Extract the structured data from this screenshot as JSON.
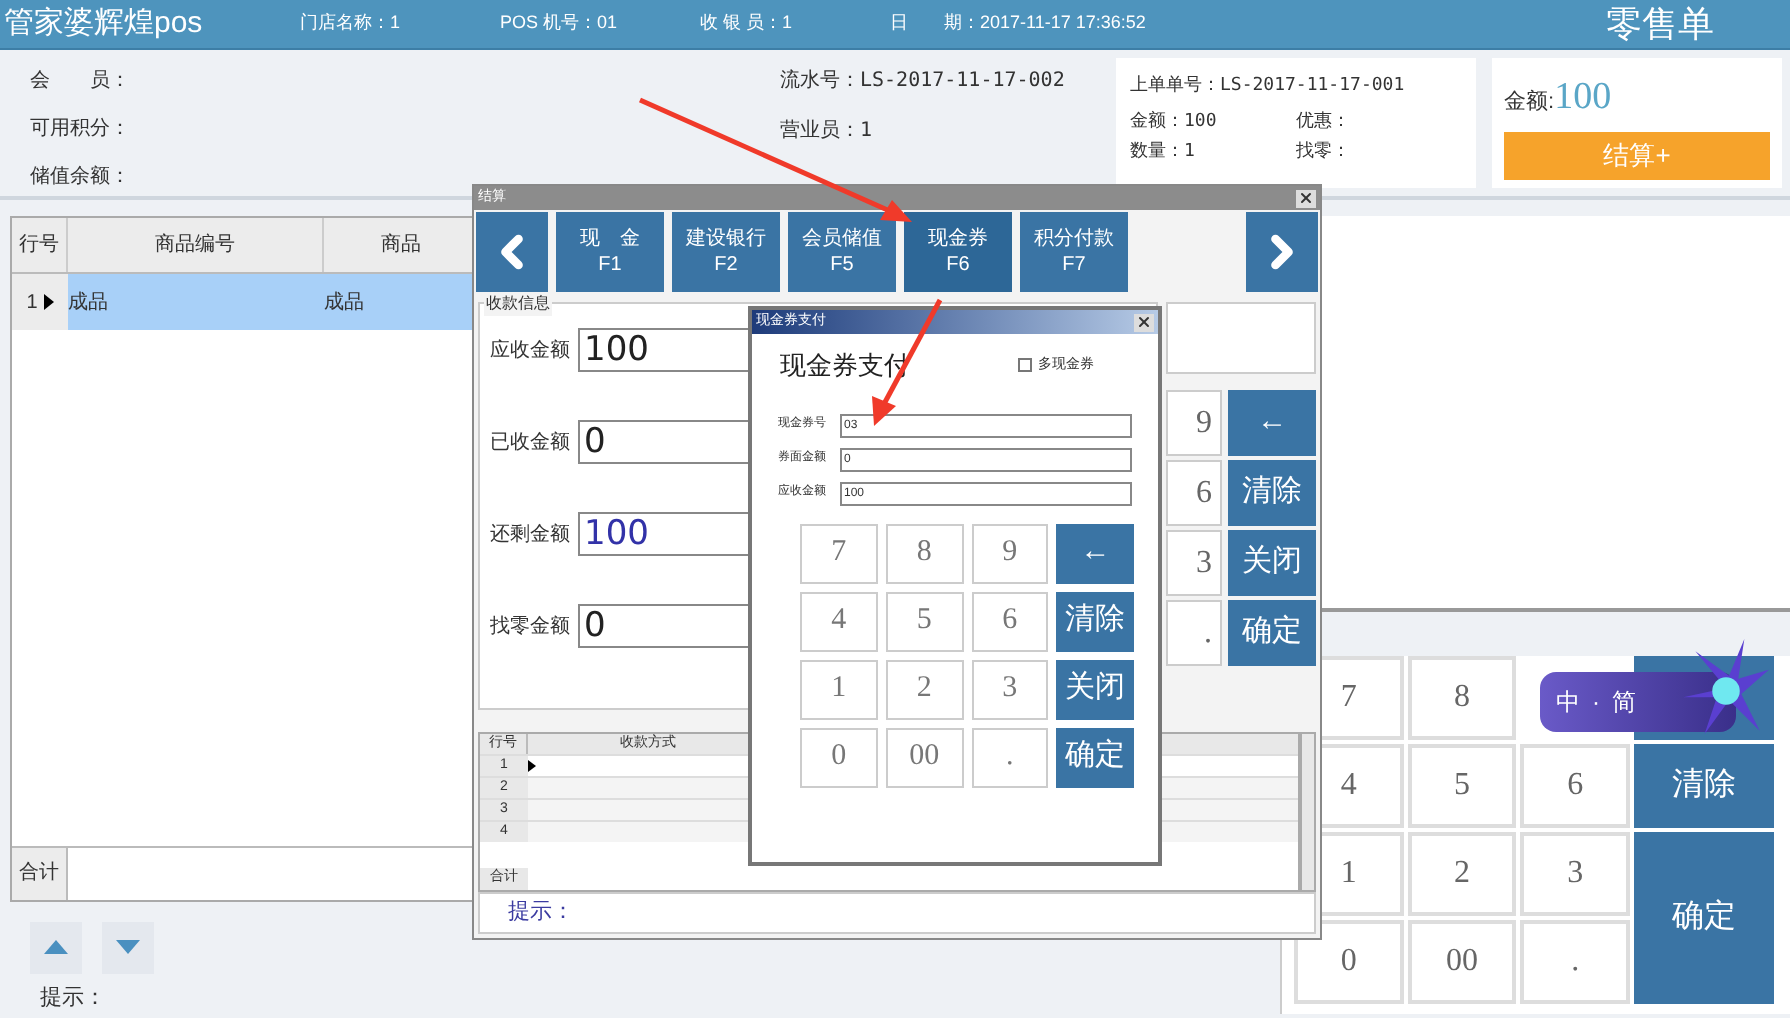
{
  "header": {
    "app_title": "管家婆辉煌pos",
    "store": "门店名称：1",
    "pos_no": "POS 机号：01",
    "cashier": "收 银 员：1",
    "date": "日　　期：2017-11-17 17:36:52",
    "doc_title": "零售单"
  },
  "member": {
    "member_label": "会　　员：",
    "points_label": "可用积分：",
    "balance_label": "储值余额：",
    "serial": "流水号：LS-2017-11-17-002",
    "clerk": "营业员：1"
  },
  "last_order": {
    "number": "上单单号：LS-2017-11-17-001",
    "amount": "金额：100",
    "discount": "优惠：",
    "quantity": "数量：1",
    "change": "找零："
  },
  "total": {
    "label": "金额:",
    "value": "100",
    "checkout_button": "结算+"
  },
  "sales_table": {
    "columns": [
      "行号",
      "商品编号",
      "商品"
    ],
    "rows": [
      {
        "cells": [
          "1",
          "成品",
          "成品"
        ],
        "selected": true
      }
    ],
    "footer": "合计"
  },
  "hint": "提示：",
  "main_keypad": {
    "digit_rows": [
      [
        "7",
        "8"
      ],
      [
        "4",
        "5",
        "6"
      ],
      [
        "1",
        "2",
        "3"
      ],
      [
        "0",
        "00",
        "."
      ]
    ],
    "actions": [
      "清除",
      "确定"
    ]
  },
  "settle_dialog": {
    "title": "结算",
    "methods": [
      {
        "label": "现　金",
        "key": "F1",
        "selected": false
      },
      {
        "label": "建设银行",
        "key": "F2",
        "selected": false
      },
      {
        "label": "会员储值",
        "key": "F5",
        "selected": false
      },
      {
        "label": "现金券",
        "key": "F6",
        "selected": true
      },
      {
        "label": "积分付款",
        "key": "F7",
        "selected": false
      }
    ],
    "group_title": "收款信息",
    "fields": [
      {
        "label": "应收金额",
        "value": "100",
        "kind": "normal"
      },
      {
        "label": "已收金额",
        "value": "0",
        "kind": "normal"
      },
      {
        "label": "还剩金额",
        "value": "100",
        "kind": "highlight"
      },
      {
        "label": "找零金额",
        "value": "0",
        "kind": "normal"
      }
    ],
    "keypad": [
      {
        "digit": "9",
        "action": "←"
      },
      {
        "digit": "6",
        "action": "清除"
      },
      {
        "digit": "3",
        "action": "关闭"
      },
      {
        "digit": ".",
        "action": "确定"
      }
    ],
    "table": {
      "columns": [
        "行号",
        "收款方式"
      ],
      "rows": [
        {
          "number": "1",
          "selected": true
        },
        {
          "number": "2",
          "selected": false
        },
        {
          "number": "3",
          "selected": false
        },
        {
          "number": "4",
          "selected": false
        }
      ],
      "footer": "合计"
    },
    "hint": "提示："
  },
  "voucher_dialog": {
    "title": "现金券支付",
    "heading": "现金券支付",
    "multi": {
      "label": "多现金券",
      "checked": false
    },
    "fields": [
      {
        "label": "现金券号",
        "value": "03"
      },
      {
        "label": "券面金额",
        "value": "0"
      },
      {
        "label": "应收金额",
        "value": "100"
      }
    ],
    "keys": [
      {
        "label": "7",
        "kind": "digit"
      },
      {
        "label": "8",
        "kind": "digit"
      },
      {
        "label": "9",
        "kind": "digit"
      },
      {
        "label": "←",
        "kind": "action"
      },
      {
        "label": "4",
        "kind": "digit"
      },
      {
        "label": "5",
        "kind": "digit"
      },
      {
        "label": "6",
        "kind": "digit"
      },
      {
        "label": "清除",
        "kind": "action"
      },
      {
        "label": "1",
        "kind": "digit"
      },
      {
        "label": "2",
        "kind": "digit"
      },
      {
        "label": "3",
        "kind": "digit"
      },
      {
        "label": "关闭",
        "kind": "action"
      },
      {
        "label": "0",
        "kind": "digit"
      },
      {
        "label": "00",
        "kind": "digit"
      },
      {
        "label": ".",
        "kind": "digit"
      },
      {
        "label": "确定",
        "kind": "action"
      }
    ]
  },
  "ime": {
    "mode": "中",
    "separator": "·",
    "script": "简"
  }
}
